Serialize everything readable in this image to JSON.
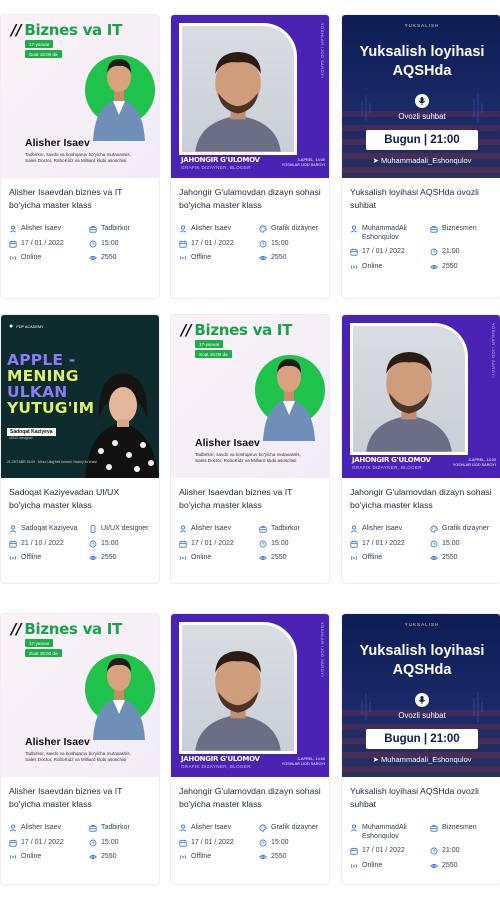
{
  "cards": [
    {
      "banner": "biz",
      "title": "Alisher Isaevdan biznes va IT bo'yicha master klass",
      "speaker": "Alisher Isaev",
      "category": "Tadbirkor",
      "date": "17 / 01 / 2022",
      "time": "15:00",
      "mode": "Online",
      "views": "2550"
    },
    {
      "banner": "jah",
      "title": "Jahongir G'ulamovdan dizayn sohasi bo'yicha master klass",
      "speaker": "Alisher Isaev",
      "category": "Grafik dizayner",
      "date": "17 / 01 / 2022",
      "time": "15:00",
      "mode": "Offline",
      "views": "2550"
    },
    {
      "banner": "yuk",
      "title": "Yuksalish loyihasi AQSHda ovozli suhbat",
      "speaker": "MuhammadAli Eshonqulov",
      "category": "Biznesmen",
      "date": "17 / 01 / 2022",
      "time": "21:00",
      "mode": "Online",
      "views": "2550"
    },
    {
      "banner": "app",
      "title": "Sadoqat Kaziyevadan UI/UX bo'yicha master klass",
      "speaker": "Sadoqat Kaziyeva",
      "category": "UI/UX designer",
      "date": "21 / 10 / 2022",
      "time": "15:00",
      "mode": "Offline",
      "views": "2550"
    },
    {
      "banner": "biz",
      "title": "Alisher Isaevdan biznes va IT bo'yicha master klass",
      "speaker": "Alisher Isaev",
      "category": "Tadbirkor",
      "date": "17 / 01 / 2022",
      "time": "15:00",
      "mode": "Online",
      "views": "2550"
    },
    {
      "banner": "jah",
      "title": "Jahongir G'ulamovdan dizayn sohasi bo'yicha master klass",
      "speaker": "Alisher Isaev",
      "category": "Grafik dizayner",
      "date": "17 / 01 / 2022",
      "time": "15:00",
      "mode": "Offline",
      "views": "2550"
    },
    {
      "banner": "biz",
      "title": "Alisher Isaevdan biznes va IT bo'yicha master klass",
      "speaker": "Alisher Isaev",
      "category": "Tadbirkor",
      "date": "17 / 01 / 2022",
      "time": "15:00",
      "mode": "Online",
      "views": "2550"
    },
    {
      "banner": "jah",
      "title": "Jahongir G'ulamovdan dizayn sohasi bo'yicha master klass",
      "speaker": "Alisher Isaev",
      "category": "Grafik dizayner",
      "date": "17 / 01 / 2022",
      "time": "15:00",
      "mode": "Offline",
      "views": "2550"
    },
    {
      "banner": "yuk",
      "title": "Yuksalish loyihasi AQSHda ovozli suhbat",
      "speaker": "MuhammadAli Eshonqulov",
      "category": "Biznesmen",
      "date": "17 / 01 / 2022",
      "time": "21:00",
      "mode": "Online",
      "views": "2550"
    }
  ],
  "banners": {
    "biz": {
      "heading": "Biznes va IT",
      "date_pill": "17-yanvar",
      "time_pill": "Soat 15:00 da",
      "name": "Alisher Isaev",
      "desc": "Tadbirkor, savdo va boshqaruv bo'yicha mutaxassis, Sales Doctor, RoboKidz va Milliard klubi asoschisi"
    },
    "jah": {
      "name": "JAHONGIR G'ULOMOV",
      "role": "GRAFIK DIZAYNER, BLOGER",
      "date": "3-APREL, 14:00",
      "place": "YOSHLAR IJOD SAROYI",
      "vertical": "YOSHLAR IJOD SAROYI"
    },
    "yuk": {
      "logo": "YUKSALISH",
      "title": "Yuksalish loyihasi AQSHda",
      "subtitle": "Ovozli suhbat",
      "schedule": "Bugun | 21:00",
      "handle": "Muhammadali_Eshonqulov"
    },
    "app": {
      "logo": "PDP ACADEMY",
      "line1": "APPLE -",
      "line2": "MENING",
      "line3": "ULKAN",
      "line4": "YUTUG'IM",
      "name": "Sadoqat Kaziyeva",
      "role": "UI/UX designer",
      "date": "21-OKTABR 15:00",
      "place": "Mirzo Ulug'bek tumani, Navoiy ko'chasi"
    }
  },
  "colors": {
    "icon_blue": "#2f6fe4",
    "biz_green": "#1fad48",
    "jah_purple": "#4b23b4",
    "yuk_navy": "#0d1d55",
    "app_teal": "#0e2b2d"
  }
}
